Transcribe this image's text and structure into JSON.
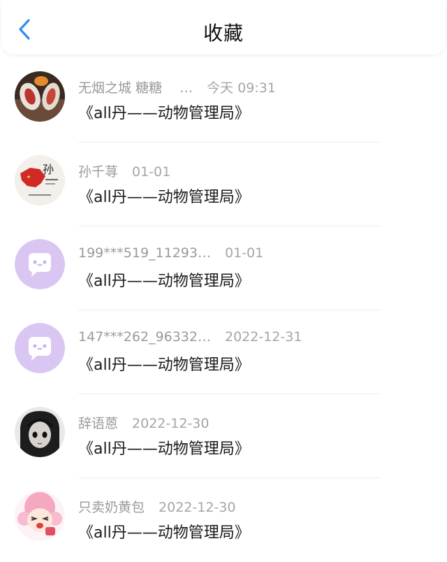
{
  "header": {
    "title": "收藏",
    "back_icon": "chevron-left-icon",
    "accent": "#2f8cf5"
  },
  "favorites": [
    {
      "user": "无烟之城 糖糖 　…",
      "time": "今天 09:31",
      "work": "《all丹——动物管理局》",
      "avatar": "photo"
    },
    {
      "user": "孙千荨",
      "time": "01-01",
      "work": "《all丹——动物管理局》",
      "avatar": "flag-calligraphy"
    },
    {
      "user": "199***519_11293…",
      "time": "01-01",
      "work": "《all丹——动物管理局》",
      "avatar": "default-chat-bubble"
    },
    {
      "user": "147***262_96332…",
      "time": "2022-12-31",
      "work": "《all丹——动物管理局》",
      "avatar": "default-chat-bubble"
    },
    {
      "user": "辞语蒽",
      "time": "2022-12-30",
      "work": "《all丹——动物管理局》",
      "avatar": "anime-dark-hair"
    },
    {
      "user": "只卖奶黄包",
      "time": "2022-12-30",
      "work": "《all丹——动物管理局》",
      "avatar": "anime-pink-hair"
    }
  ],
  "colors": {
    "default_avatar_bg": "#d9c6f3",
    "meta_text": "#9a9a9a",
    "divider": "#eeeeee"
  }
}
